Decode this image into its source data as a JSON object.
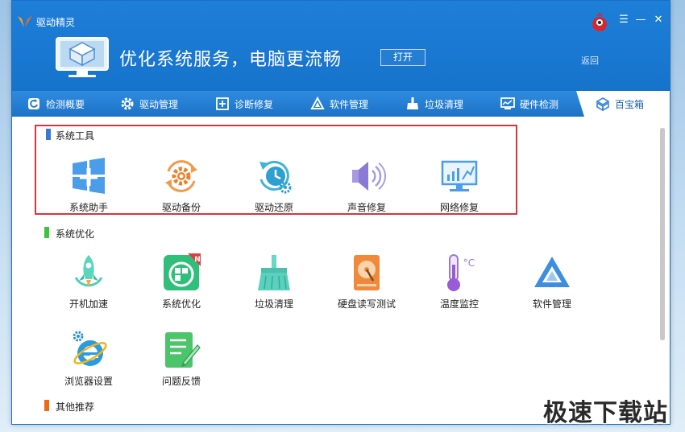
{
  "window": {
    "title": "驱动精灵",
    "slogan": "优化系统服务，电脑更流畅",
    "open_label": "打开",
    "back_label": "返回",
    "minimize_glyph": "—",
    "menu_glyph": "☰",
    "close_glyph": "✕"
  },
  "tabs": [
    {
      "label": "检测概要",
      "icon": "refresh-icon"
    },
    {
      "label": "驱动管理",
      "icon": "gear-icon"
    },
    {
      "label": "诊断修复",
      "icon": "diagnose-icon"
    },
    {
      "label": "软件管理",
      "icon": "software-icon"
    },
    {
      "label": "垃圾清理",
      "icon": "broom-icon"
    },
    {
      "label": "硬件检测",
      "icon": "hardware-icon"
    },
    {
      "label": "百宝箱",
      "icon": "toolbox-icon",
      "active": true
    }
  ],
  "sections": {
    "system_tools": {
      "title": "系统工具",
      "color": "#3a78d8",
      "items": [
        {
          "label": "系统助手",
          "icon": "windows-plus-icon"
        },
        {
          "label": "驱动备份",
          "icon": "gear-backup-icon"
        },
        {
          "label": "驱动还原",
          "icon": "clock-restore-icon"
        },
        {
          "label": "声音修复",
          "icon": "speaker-icon"
        },
        {
          "label": "网络修复",
          "icon": "network-monitor-icon"
        }
      ]
    },
    "system_optimize": {
      "title": "系统优化",
      "color": "#3cc43c",
      "items": [
        {
          "label": "开机加速",
          "icon": "rocket-icon"
        },
        {
          "label": "系统优化",
          "icon": "optimize-icon",
          "badge": "N"
        },
        {
          "label": "垃圾清理",
          "icon": "broom-clean-icon"
        },
        {
          "label": "硬盘读写测试",
          "icon": "harddisk-icon"
        },
        {
          "label": "温度监控",
          "icon": "thermometer-icon",
          "unit": "°C"
        },
        {
          "label": "软件管理",
          "icon": "triangle-software-icon"
        },
        {
          "label": "浏览器设置",
          "icon": "ie-browser-icon"
        },
        {
          "label": "问题反馈",
          "icon": "feedback-icon"
        }
      ]
    },
    "other": {
      "title": "其他推荐",
      "color": "#ea6a1a"
    }
  },
  "watermark": "极速下载站"
}
